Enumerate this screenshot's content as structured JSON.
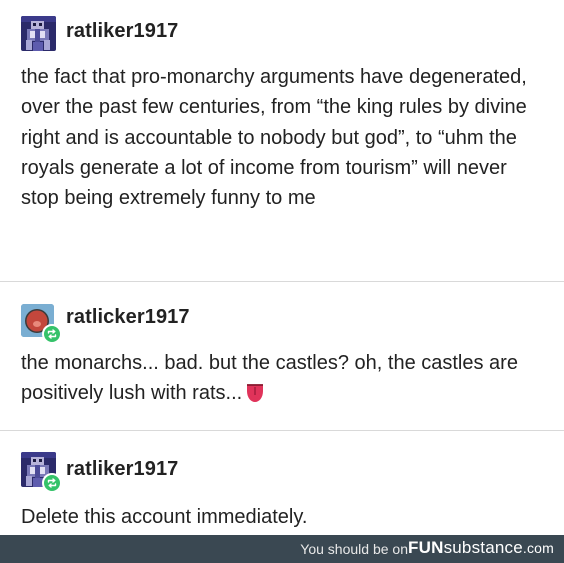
{
  "posts": [
    {
      "username": "ratliker1917",
      "avatar_icon": "pixel-knight-avatar-icon",
      "text": "the fact that pro-monarchy arguments have degenerated, over the past few centuries, from “the king rules by divine right and is accountable to nobody but god”, to “uhm the royals generate a lot of income from tourism” will never stop being extremely funny to me"
    },
    {
      "username": "ratlicker1917",
      "avatar_icon": "red-tongue-face-avatar-icon",
      "reblogged": true,
      "text": "the monarchs... bad. but the castles? oh, the castles are positively lush with rats...",
      "emoji": "tongue-emoji-icon"
    },
    {
      "username": "ratliker1917",
      "avatar_icon": "pixel-knight-avatar-icon",
      "reblogged": true,
      "text": "Delete this account immediately."
    }
  ],
  "footer": {
    "text": "You should be on",
    "brand_prefix": "FUN",
    "brand_suffix": "substance",
    "brand_domain": ".com"
  },
  "colors": {
    "reblog_badge": "#35c26a",
    "footer_bg": "#3a4852",
    "avatar2_bg": "#6fa3c9",
    "avatar2_face": "#c3473c"
  }
}
